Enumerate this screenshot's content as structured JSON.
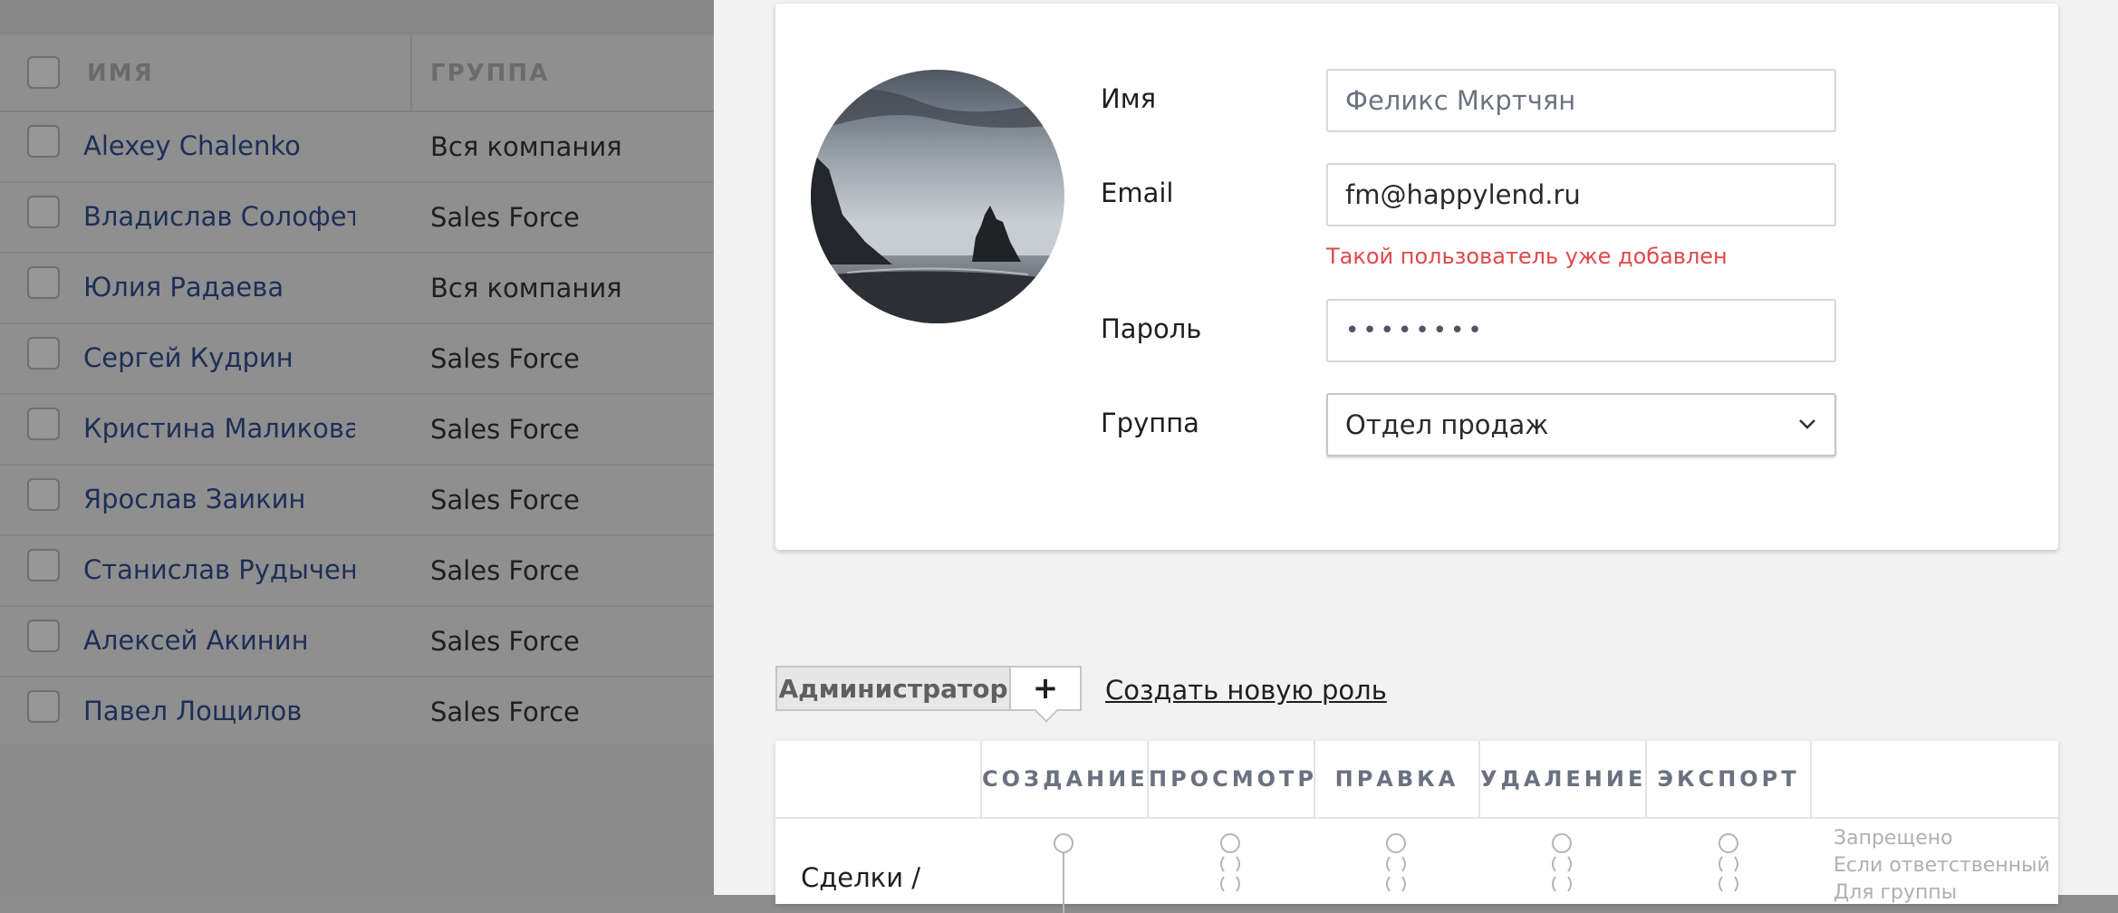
{
  "users_table": {
    "columns": {
      "name": "ИМЯ",
      "group": "ГРУППА"
    },
    "rows": [
      {
        "name": "Alexey Chalenko",
        "group": "Вся компания"
      },
      {
        "name": "Владислав Солофетник",
        "group": "Sales Force"
      },
      {
        "name": "Юлия Радаева",
        "group": "Вся компания"
      },
      {
        "name": "Сергей Кудрин",
        "group": "Sales Force"
      },
      {
        "name": "Кристина Маликова",
        "group": "Sales Force"
      },
      {
        "name": "Ярослав Заикин",
        "group": "Sales Force"
      },
      {
        "name": "Станислав Рудыченко",
        "group": "Sales Force"
      },
      {
        "name": "Алексей Акинин",
        "group": "Sales Force"
      },
      {
        "name": "Павел Лощилов",
        "group": "Sales Force"
      }
    ]
  },
  "user_form": {
    "name_label": "Имя",
    "name_placeholder": "Феликс Мкртчян",
    "email_label": "Email",
    "email_value": "fm@happylend.ru",
    "email_error": "Такой пользователь уже добавлен",
    "password_label": "Пароль",
    "password_value": "••••••••",
    "group_label": "Группа",
    "group_value": "Отдел продаж"
  },
  "roles": {
    "active_role": "Администратор",
    "add_label": "+",
    "create_link": "Создать новую роль"
  },
  "permissions": {
    "columns": [
      "СОЗДАНИЕ",
      "ПРОСМОТР",
      "ПРАВКА",
      "УДАЛЕНИЕ",
      "ЭКСПОРТ"
    ],
    "row_label": "Сделки /",
    "legend": [
      "Запрещено",
      "Если ответственный",
      "Для группы"
    ]
  },
  "colors": {
    "error": "#e0484a",
    "link_name": "#1d2f58",
    "overlay": "#8f8f8f"
  }
}
